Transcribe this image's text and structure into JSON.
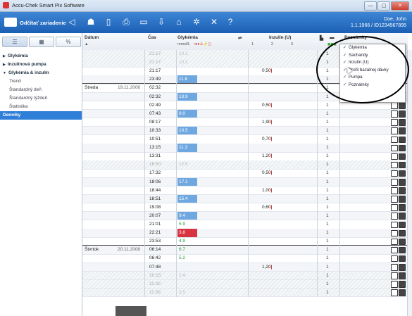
{
  "window": {
    "title": "Accu-Chek Smart Pix Software",
    "buttons": [
      "—",
      "▢",
      "✕"
    ]
  },
  "toolbar": {
    "read_device_label": "Odčítať zariadenie",
    "icons": [
      "back-arrow-icon",
      "people-icon",
      "document-icon",
      "print-icon",
      "save-icon",
      "export-icon",
      "home-icon",
      "settings-gear-icon",
      "tools-icon",
      "help-icon"
    ],
    "user_name": "Doe, John",
    "user_detail": "1.1.1966 / ID1234567895"
  },
  "sidebar": {
    "tabs": [
      "☰",
      "▦",
      "%"
    ],
    "items": [
      {
        "label": "Glykémia",
        "type": "group",
        "expander": "▶"
      },
      {
        "label": "Inzulínová pumpa",
        "type": "group",
        "expander": "▶"
      },
      {
        "label": "Glykémia & inzulín",
        "type": "group",
        "expander": "▼"
      },
      {
        "label": "Trend",
        "type": "sub"
      },
      {
        "label": "Štandardný deň",
        "type": "sub"
      },
      {
        "label": "Štandardný týždeň",
        "type": "sub"
      },
      {
        "label": "Štatistika",
        "type": "sub"
      },
      {
        "label": "Denníky",
        "type": "selected"
      }
    ]
  },
  "grid": {
    "headers": {
      "date": "Dátum",
      "time": "Čas",
      "glucose": "Glykémia",
      "glucose_unit": "mmol/L",
      "insulin": "Inzulín (U)",
      "insulin_cols": [
        "1",
        "2",
        "3"
      ],
      "notes": "Poznámky"
    },
    "days": [
      {
        "day": "Streda",
        "date": "19.11.2008"
      },
      {
        "day": "Štvrtok",
        "date": "20.11.2008"
      }
    ],
    "rows": [
      {
        "time": "21:17",
        "glu": "10.1",
        "gstyle": "faint",
        "ins": "",
        "hatch": true
      },
      {
        "time": "21:17",
        "glu": "10.1",
        "gstyle": "faint",
        "ins": "",
        "hatch": true
      },
      {
        "time": "21:17",
        "glu": "",
        "gstyle": "",
        "ins": "0,50",
        "hatch": false
      },
      {
        "time": "23:49",
        "glu": "11.8",
        "gstyle": "blue",
        "ins": "",
        "hatch": false
      },
      {
        "time": "02:32",
        "glu": "",
        "gstyle": "",
        "ins": "",
        "hatch": false
      },
      {
        "time": "02:32",
        "glu": "13.9",
        "gstyle": "blue",
        "ins": "",
        "hatch": false
      },
      {
        "time": "02:49",
        "glu": "",
        "gstyle": "",
        "ins": "0,50",
        "hatch": false
      },
      {
        "time": "07:43",
        "glu": "9.0",
        "gstyle": "blue",
        "ins": "",
        "hatch": false
      },
      {
        "time": "08:17",
        "glu": "",
        "gstyle": "",
        "ins": "1,90",
        "hatch": false
      },
      {
        "time": "10:33",
        "glu": "10.5",
        "gstyle": "blue",
        "ins": "",
        "hatch": false
      },
      {
        "time": "10:51",
        "glu": "",
        "gstyle": "",
        "ins": "0,70",
        "hatch": false
      },
      {
        "time": "13:15",
        "glu": "11.3",
        "gstyle": "blue",
        "ins": "",
        "hatch": false
      },
      {
        "time": "13:31",
        "glu": "",
        "gstyle": "",
        "ins": "1,20",
        "hatch": false
      },
      {
        "time": "16:50",
        "glu": "12.5",
        "gstyle": "faint",
        "ins": "",
        "hatch": true
      },
      {
        "time": "17:32",
        "glu": "",
        "gstyle": "",
        "ins": "0,50",
        "hatch": false
      },
      {
        "time": "18:06",
        "glu": "17.1",
        "gstyle": "blue",
        "ins": "",
        "hatch": false
      },
      {
        "time": "18:44",
        "glu": "",
        "gstyle": "",
        "ins": "1,00",
        "hatch": false
      },
      {
        "time": "18:51",
        "glu": "15.4",
        "gstyle": "blue",
        "ins": "",
        "hatch": false
      },
      {
        "time": "19:08",
        "glu": "",
        "gstyle": "",
        "ins": "0,60",
        "hatch": false
      },
      {
        "time": "20:07",
        "glu": "9.4",
        "gstyle": "blue",
        "ins": "",
        "hatch": false
      },
      {
        "time": "21:01",
        "glu": "5.9",
        "gstyle": "green",
        "ins": "",
        "hatch": false
      },
      {
        "time": "22:21",
        "glu": "3.8",
        "gstyle": "red",
        "ins": "",
        "hatch": false
      },
      {
        "time": "23:53",
        "glu": "4.9",
        "gstyle": "green",
        "ins": "",
        "hatch": false
      },
      {
        "time": "06:14",
        "glu": "6.7",
        "gstyle": "green",
        "ins": "",
        "hatch": false
      },
      {
        "time": "06:42",
        "glu": "5.2",
        "gstyle": "green",
        "ins": "",
        "hatch": false
      },
      {
        "time": "07:48",
        "glu": "",
        "gstyle": "",
        "ins": "1,20",
        "hatch": false
      },
      {
        "time": "10:15",
        "glu": "2.4",
        "gstyle": "faint",
        "ins": "",
        "hatch": true
      },
      {
        "time": "11:30",
        "glu": "",
        "gstyle": "faint",
        "ins": "",
        "hatch": true
      },
      {
        "time": "11:30",
        "glu": "3.5",
        "gstyle": "faint",
        "ins": "",
        "hatch": true
      }
    ]
  },
  "popup": {
    "items": [
      {
        "label": "Glykémia",
        "checked": true
      },
      {
        "label": "Sacharidy",
        "checked": true
      },
      {
        "label": "Inzulín (U)",
        "checked": true
      },
      {
        "label": "Profil bazálnej dávky",
        "checked": true
      },
      {
        "label": "Pumpa",
        "checked": true
      },
      {
        "label": "Poznámky",
        "checked": true
      }
    ]
  },
  "colors": {
    "toolbar": "#1f66bd",
    "selected": "#2f7ed8",
    "glucose_high": "#6fa8e0",
    "glucose_low": "#d83340",
    "glucose_ok": "#2a9a3a"
  }
}
